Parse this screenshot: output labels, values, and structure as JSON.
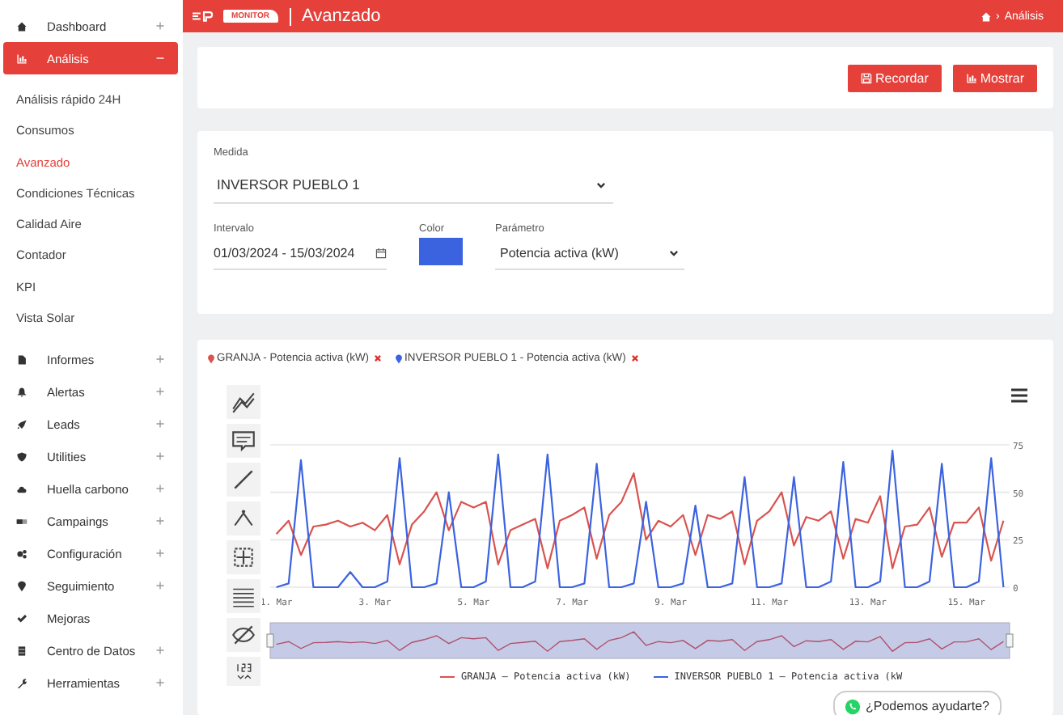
{
  "sidebar": {
    "items": [
      {
        "label": "Dashboard",
        "kind": "group",
        "expanded": false,
        "selected": false
      },
      {
        "label": "Análisis",
        "kind": "group",
        "expanded": true,
        "selected": true,
        "children": [
          {
            "label": "Análisis rápido 24H",
            "selected": false
          },
          {
            "label": "Consumos",
            "selected": false
          },
          {
            "label": "Avanzado",
            "selected": true
          },
          {
            "label": "Condiciones Técnicas",
            "selected": false
          },
          {
            "label": "Calidad Aire",
            "selected": false
          },
          {
            "label": "Contador",
            "selected": false
          },
          {
            "label": "KPI",
            "selected": false
          },
          {
            "label": "Vista Solar",
            "selected": false
          }
        ]
      },
      {
        "label": "Informes",
        "kind": "group",
        "expanded": false,
        "selected": false
      },
      {
        "label": "Alertas",
        "kind": "group",
        "expanded": false,
        "selected": false
      },
      {
        "label": "Leads",
        "kind": "group",
        "expanded": false,
        "selected": false
      },
      {
        "label": "Utilities",
        "kind": "group",
        "expanded": false,
        "selected": false
      },
      {
        "label": "Huella carbono",
        "kind": "group",
        "expanded": false,
        "selected": false
      },
      {
        "label": "Campaings",
        "kind": "group",
        "expanded": false,
        "selected": false
      },
      {
        "label": "Configuración",
        "kind": "group",
        "expanded": false,
        "selected": false
      },
      {
        "label": "Seguimiento",
        "kind": "group",
        "expanded": false,
        "selected": false
      },
      {
        "label": "Mejoras",
        "kind": "link",
        "expanded": false,
        "selected": false
      },
      {
        "label": "Centro de Datos",
        "kind": "group",
        "expanded": false,
        "selected": false
      },
      {
        "label": "Herramientas",
        "kind": "group",
        "expanded": false,
        "selected": false
      }
    ]
  },
  "header": {
    "badge": "MONITOR",
    "title": "Avanzado",
    "breadcrumb": {
      "separator": "›",
      "current": "Análisis"
    }
  },
  "actions": [
    {
      "label": "Recordar",
      "kind": "save"
    },
    {
      "label": "Mostrar",
      "kind": "chart"
    }
  ],
  "form": {
    "medida": {
      "label": "Medida",
      "value": "INVERSOR PUEBLO 1"
    },
    "intervalo": {
      "label": "Intervalo",
      "value": "01/03/2024 - 15/03/2024"
    },
    "color": {
      "label": "Color",
      "color": "#3b63e0"
    },
    "parametro": {
      "label": "Parámetro",
      "value": "Potencia activa (kW)"
    }
  },
  "chart": {
    "tags": [
      {
        "label": "GRANJA - Potencia activa (kW)",
        "color": "#d9534f"
      },
      {
        "label": "INVERSOR PUEBLO 1 - Potencia activa (kW)",
        "color": "#3b63e0"
      }
    ],
    "chart_data": {
      "type": "line",
      "grid": true,
      "legend": "bottom",
      "ylim": [
        0,
        75
      ],
      "yticks": [
        0,
        25,
        50,
        75
      ],
      "categories": [
        "1. Mar",
        null,
        null,
        null,
        null,
        null,
        null,
        null,
        "3. Mar",
        null,
        null,
        null,
        null,
        null,
        null,
        null,
        "5. Mar",
        null,
        null,
        null,
        null,
        null,
        null,
        null,
        "7. Mar",
        null,
        null,
        null,
        null,
        null,
        null,
        null,
        "9. Mar",
        null,
        null,
        null,
        null,
        null,
        null,
        null,
        "11. Mar",
        null,
        null,
        null,
        null,
        null,
        null,
        null,
        "13. Mar",
        null,
        null,
        null,
        null,
        null,
        null,
        null,
        "15. Mar",
        null,
        null,
        null
      ],
      "series": [
        {
          "name": "GRANJA – Potencia activa (kW)",
          "color": "#d9534f",
          "values": [
            28,
            35,
            17,
            32,
            33,
            35,
            32,
            34,
            30,
            38,
            12,
            33,
            40,
            50,
            30,
            45,
            42,
            45,
            12,
            30,
            33,
            36,
            10,
            35,
            38,
            42,
            15,
            38,
            45,
            60,
            25,
            35,
            32,
            38,
            17,
            38,
            36,
            40,
            12,
            35,
            40,
            50,
            22,
            37,
            35,
            40,
            15,
            36,
            34,
            48,
            10,
            32,
            33,
            42,
            16,
            34,
            34,
            42,
            14,
            35
          ]
        },
        {
          "name": "INVERSOR PUEBLO 1 – Potencia activa (kW",
          "color": "#3b63e0",
          "values": [
            0,
            2,
            67,
            0,
            0,
            0,
            8,
            0,
            0,
            3,
            68,
            0,
            0,
            2,
            50,
            0,
            0,
            3,
            70,
            0,
            0,
            3,
            70,
            0,
            0,
            2,
            65,
            0,
            0,
            2,
            45,
            0,
            0,
            2,
            43,
            0,
            0,
            2,
            58,
            0,
            0,
            2,
            58,
            0,
            0,
            3,
            66,
            0,
            0,
            3,
            72,
            0,
            0,
            3,
            65,
            0,
            0,
            3,
            68,
            0
          ]
        }
      ]
    }
  },
  "chat": {
    "label": "¿Podemos ayudarte?"
  }
}
